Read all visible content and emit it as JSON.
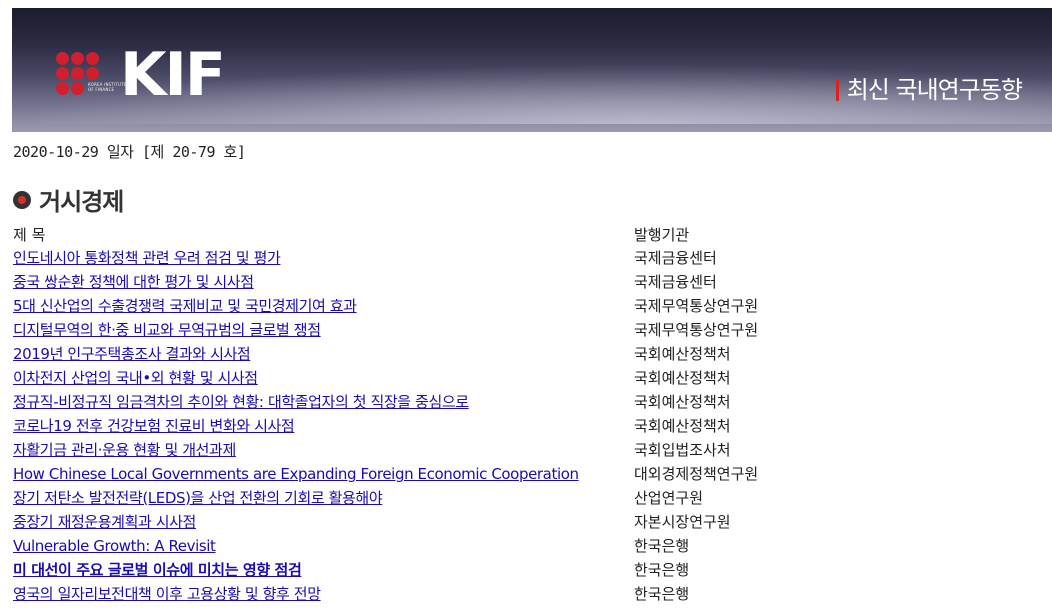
{
  "banner": {
    "logo_text": "KIF",
    "logo_small": "KOREA INSTITUTE OF FINANCE",
    "title": "최신 국내연구동향"
  },
  "issue_line": "2020-10-29 일자 [제 20-79 호]",
  "section": {
    "heading": "거시경제"
  },
  "columns": {
    "title": "제 목",
    "publisher": "발행기관"
  },
  "articles": [
    {
      "title": "인도네시아 통화정책 관련 우려 점검 및 평가",
      "org": "국제금융센터"
    },
    {
      "title": "중국 쌍순환 정책에 대한 평가 및 시사점",
      "org": "국제금융센터"
    },
    {
      "title": "5대 신산업의 수출경쟁력 국제비교 및 국민경제기여 효과",
      "org": "국제무역통상연구원"
    },
    {
      "title": "디지털무역의 한·중 비교와 무역규범의 글로벌 쟁점",
      "org": "국제무역통상연구원"
    },
    {
      "title": "2019년 인구주택총조사 결과와 시사점",
      "org": "국회예산정책처"
    },
    {
      "title": "이차전지 산업의 국내•외 현황 및 시사점",
      "org": "국회예산정책처"
    },
    {
      "title": "정규직-비정규직 임금격차의 추이와 현황: 대학졸업자의 첫 직장을 중심으로",
      "org": "국회예산정책처"
    },
    {
      "title": "코로나19 전후 건강보험 진료비 변화와 시사점",
      "org": "국회예산정책처"
    },
    {
      "title": "자활기금 관리·운용 현황 및 개선과제",
      "org": "국회입법조사처"
    },
    {
      "title": "How Chinese Local Governments are Expanding Foreign Economic Cooperation",
      "org": "대외경제정책연구원"
    },
    {
      "title": "장기 저탄소 발전전략(LEDS)을 산업 전환의 기회로 활용해야",
      "org": "산업연구원"
    },
    {
      "title": "중장기 재정운용계획과 시사점",
      "org": "자본시장연구원"
    },
    {
      "title": "Vulnerable Growth: A Revisit",
      "org": "한국은행"
    },
    {
      "title": "미 대선이 주요 글로벌 이슈에 미치는 영향 점검",
      "org": "한국은행"
    },
    {
      "title": "영국의 일자리보전대책 이후 고용상황 및 향후 전망",
      "org": "한국은행"
    }
  ]
}
